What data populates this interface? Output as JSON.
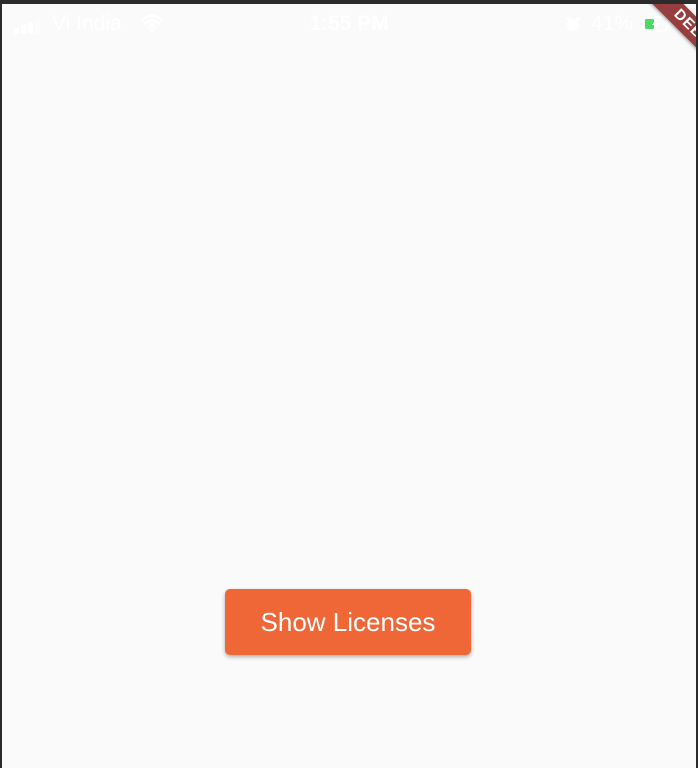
{
  "status_bar": {
    "carrier": "Vi India",
    "time": "1:55 PM",
    "battery_percent": "41%",
    "icons": [
      "signal-icon",
      "wifi-icon",
      "alarm-icon",
      "battery-charging-icon"
    ]
  },
  "debug_banner": {
    "label": "DEBUG",
    "color": "#8c2828"
  },
  "main": {
    "show_licenses_label": "Show Licenses"
  },
  "colors": {
    "button_background": "#ef6637",
    "screen_background": "#fafafa"
  }
}
